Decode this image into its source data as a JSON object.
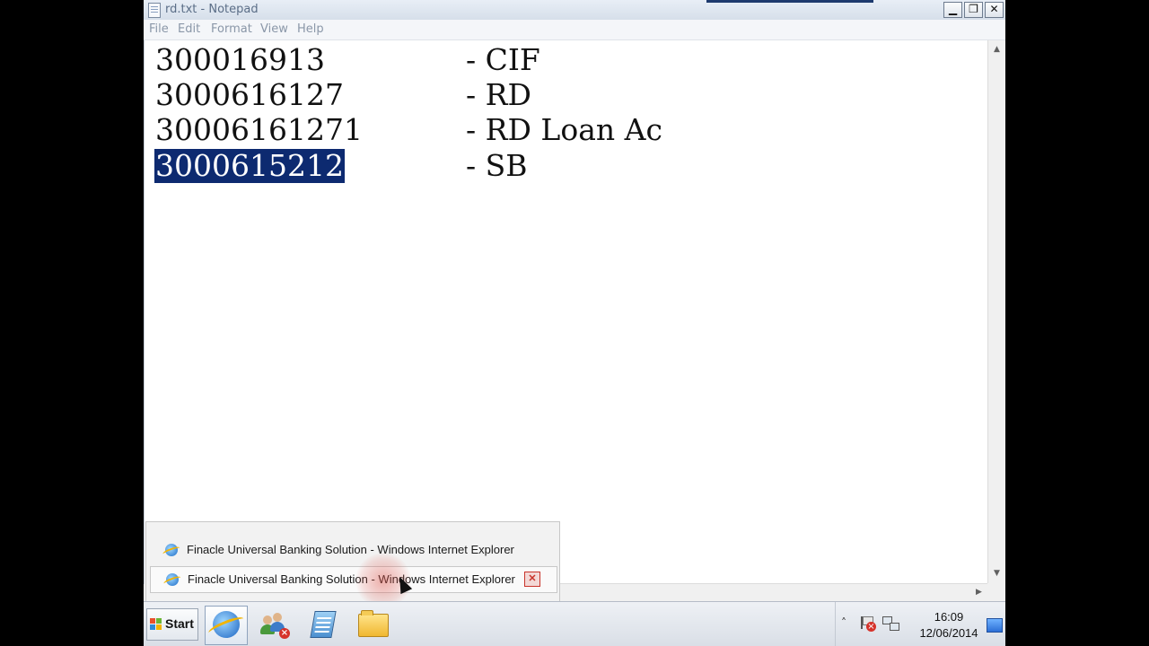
{
  "window": {
    "title": "rd.txt - Notepad",
    "minimize_glyph": "▁",
    "maximize_glyph": "❐",
    "close_glyph": "✕"
  },
  "menu": {
    "file": "File",
    "edit": "Edit",
    "format": "Format",
    "view": "View",
    "help": "Help"
  },
  "document": {
    "lines": [
      {
        "number": "300016913",
        "description": "- CIF"
      },
      {
        "number": "3000616127",
        "description": "- RD"
      },
      {
        "number": "30006161271",
        "description": "- RD Loan Ac"
      },
      {
        "number": "3000615212",
        "description": "- SB",
        "selected": true
      }
    ],
    "selection_color": "#0d2a70"
  },
  "jump_list": {
    "items": [
      {
        "label": "Finacle Universal Banking Solution - Windows Internet Explorer",
        "icon": "ie-icon"
      },
      {
        "label": "Finacle Universal Banking Solution - Windows Internet Explorer",
        "icon": "ie-icon",
        "hovered": true,
        "close_glyph": "✕"
      }
    ]
  },
  "taskbar": {
    "start_label": "Start",
    "pinned": [
      "internet-explorer-icon",
      "users-error-icon",
      "notepad-icon",
      "folder-icon"
    ],
    "tray": {
      "chevron": "˄",
      "time": "16:09",
      "date": "12/06/2014"
    }
  }
}
